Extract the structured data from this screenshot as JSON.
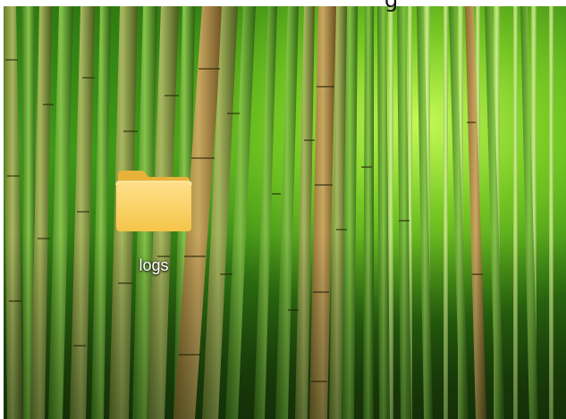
{
  "top_text": "g",
  "desktop": {
    "icons": [
      {
        "label": "logs",
        "icon": "folder-icon"
      }
    ]
  },
  "colors": {
    "folder_body": "#f7cc56",
    "folder_tab": "#e9b43a",
    "wallpaper_glow": "#c8ff5a",
    "bamboo_dark": "#1c3e0a"
  }
}
